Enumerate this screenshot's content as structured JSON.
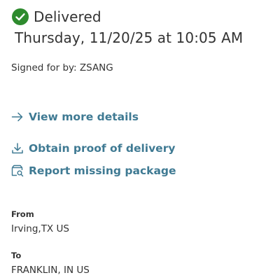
{
  "status": {
    "text": "Delivered",
    "icon": "check-circle-icon",
    "color": "#2e8b2e"
  },
  "delivery": {
    "datetime": "Thursday, 11/20/25 at 10:05 AM",
    "signed_for": "Signed for by: ZSANG"
  },
  "links": {
    "details": {
      "label": "View more details",
      "icon": "arrow-right-icon"
    },
    "proof": {
      "label": "Obtain proof of delivery",
      "icon": "download-icon"
    },
    "report": {
      "label": "Report missing package",
      "icon": "package-search-icon"
    }
  },
  "from": {
    "label": "From",
    "value": "Irving,TX US"
  },
  "to": {
    "label": "To",
    "value": "FRANKLIN, IN US"
  },
  "colors": {
    "link": "#3f7a93",
    "text": "#333333",
    "success": "#2e8b2e"
  }
}
